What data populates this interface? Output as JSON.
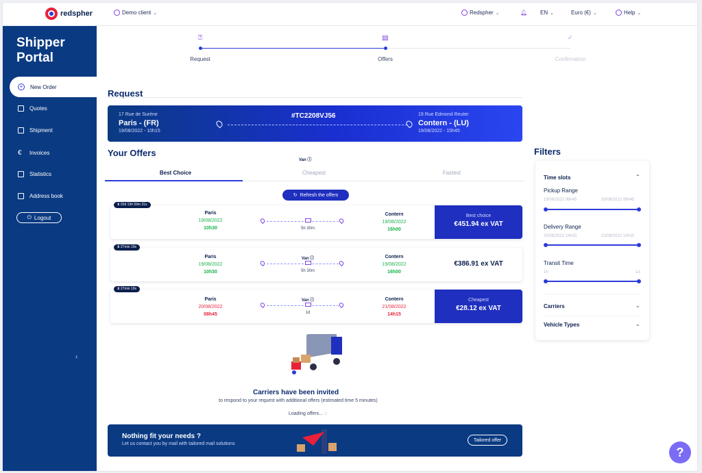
{
  "header": {
    "brand": "redspher",
    "client": "Demo client",
    "user": "Redspher",
    "language": "EN",
    "currency": "Euro (€)",
    "help": "Help"
  },
  "sidebar": {
    "title_line1": "Shipper",
    "title_line2": "Portal",
    "items": [
      {
        "label": "New Order",
        "icon": "plus-circle-icon"
      },
      {
        "label": "Quotes",
        "icon": "document-icon"
      },
      {
        "label": "Shipment",
        "icon": "list-icon"
      },
      {
        "label": "Invoices",
        "icon": "euro-icon"
      },
      {
        "label": "Statistics",
        "icon": "chart-icon"
      },
      {
        "label": "Address book",
        "icon": "address-book-icon"
      }
    ],
    "logout": "Logout",
    "collapse": "‹"
  },
  "stepper": {
    "steps": [
      {
        "label": "Request",
        "state": "done"
      },
      {
        "label": "Offers",
        "state": "active"
      },
      {
        "label": "Confirmation",
        "state": "pending"
      }
    ]
  },
  "request": {
    "heading": "Request",
    "id": "#TC2208VJ56",
    "origin": {
      "address": "17 Rue de Surène",
      "city": "Paris - (FR)",
      "datetime": "19/08/2022 - 10h15"
    },
    "destination": {
      "address": "19 Rue Edmond Reuter",
      "city": "Contern - (LU)",
      "datetime": "19/08/2022 - 15h45"
    }
  },
  "offers_section": {
    "heading": "Your Offers",
    "vehicle_label": "Van ⓘ",
    "tabs": [
      "Best Choice",
      "Cheapest",
      "Fastest"
    ],
    "refresh": "Refresh the offers"
  },
  "offers": [
    {
      "timer": "02d 13h 59m 31s",
      "from_city": "Paris",
      "from_date": "19/08/2022",
      "from_time": "10h30",
      "vehicle": "",
      "duration": "5h 30m",
      "to_city": "Contern",
      "to_date": "19/08/2022",
      "to_time": "16h00",
      "tag": "Best choice",
      "price": "€451.94 ex VAT",
      "date_color": "green"
    },
    {
      "timer": "27min 19s",
      "from_city": "Paris",
      "from_date": "19/08/2022",
      "from_time": "10h30",
      "vehicle": "Van ⓘ",
      "duration": "5h 30m",
      "to_city": "Contern",
      "to_date": "19/08/2022",
      "to_time": "16h00",
      "tag": "",
      "price": "€386.91 ex VAT",
      "date_color": "green"
    },
    {
      "timer": "27min 19s",
      "from_city": "Paris",
      "from_date": "20/08/2022",
      "from_time": "08h45",
      "vehicle": "Van ⓘ",
      "duration": "1d",
      "to_city": "Contern",
      "to_date": "21/08/2022",
      "to_time": "14h15",
      "tag": "Cheapest",
      "price": "€28.12 ex VAT",
      "date_color": "red"
    }
  ],
  "invite": {
    "title": "Carriers have been invited",
    "subtitle": "to respond to your request with additional offers (estimated time 5 minutes)",
    "loading": "Loading offers..."
  },
  "banner": {
    "title": "Nothing fit your needs ?",
    "subtitle": "Let us contact you by mail with tailored mail solutions",
    "button": "Tailored offer"
  },
  "filters": {
    "heading": "Filters",
    "time_slots": "Time slots",
    "pickup_range": "Pickup Range",
    "pickup_from": "19/08/2022 08h45",
    "pickup_to": "20/08/2022 08h45",
    "delivery_range": "Delivery Range",
    "delivery_from": "20/08/2022 14h15",
    "delivery_to": "21/08/2022 14h15",
    "transit_time": "Transit Time",
    "transit_from": "1h",
    "transit_to": "1d",
    "carriers": "Carriers",
    "vehicle_types": "Vehicle Types"
  },
  "colors": {
    "primary": "#0a3a82",
    "accent": "#1f2fbf",
    "green": "#17b34a",
    "red": "#e5253c",
    "purple": "#7b6cf6"
  },
  "help_fab": "?"
}
